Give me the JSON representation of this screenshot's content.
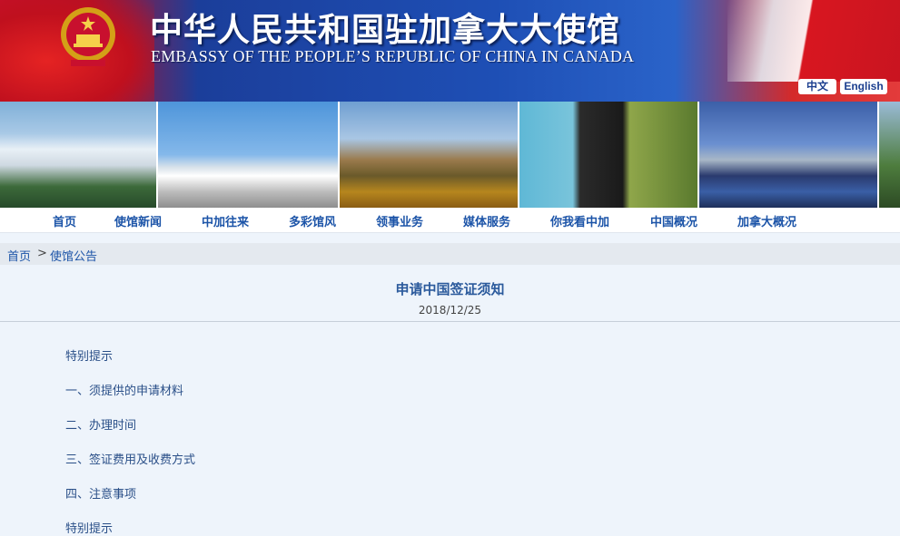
{
  "header": {
    "title_cn": "中华人民共和国驻加拿大大使馆",
    "title_en": "EMBASSY OF THE PEOPLE’S REPUBLIC OF CHINA IN CANADA",
    "lang_zh": "中文",
    "lang_en": "English"
  },
  "banner_photos": [
    "niagara-falls",
    "birds-nest-stadium",
    "great-wall",
    "totem-pole",
    "national-centre-performing-arts",
    "landscape"
  ],
  "nav": {
    "items": [
      "首页",
      "使馆新闻",
      "中加往来",
      "多彩馆风",
      "领事业务",
      "媒体服务",
      "你我看中加",
      "中国概况",
      "加拿大概况"
    ]
  },
  "breadcrumb": {
    "home": "首页",
    "separator": ">",
    "current": "使馆公告"
  },
  "article": {
    "title": "申请中国签证须知",
    "date": "2018/12/25",
    "toc": [
      "特别提示",
      "一、须提供的申请材料",
      "二、办理时间",
      "三、签证费用及收费方式",
      "四、注意事项",
      "特别提示"
    ]
  },
  "colors": {
    "header_blue": "#1e4fb5",
    "link_blue": "#1c54a8",
    "title_blue": "#2b5a9c",
    "page_bg": "#eef4fb"
  }
}
